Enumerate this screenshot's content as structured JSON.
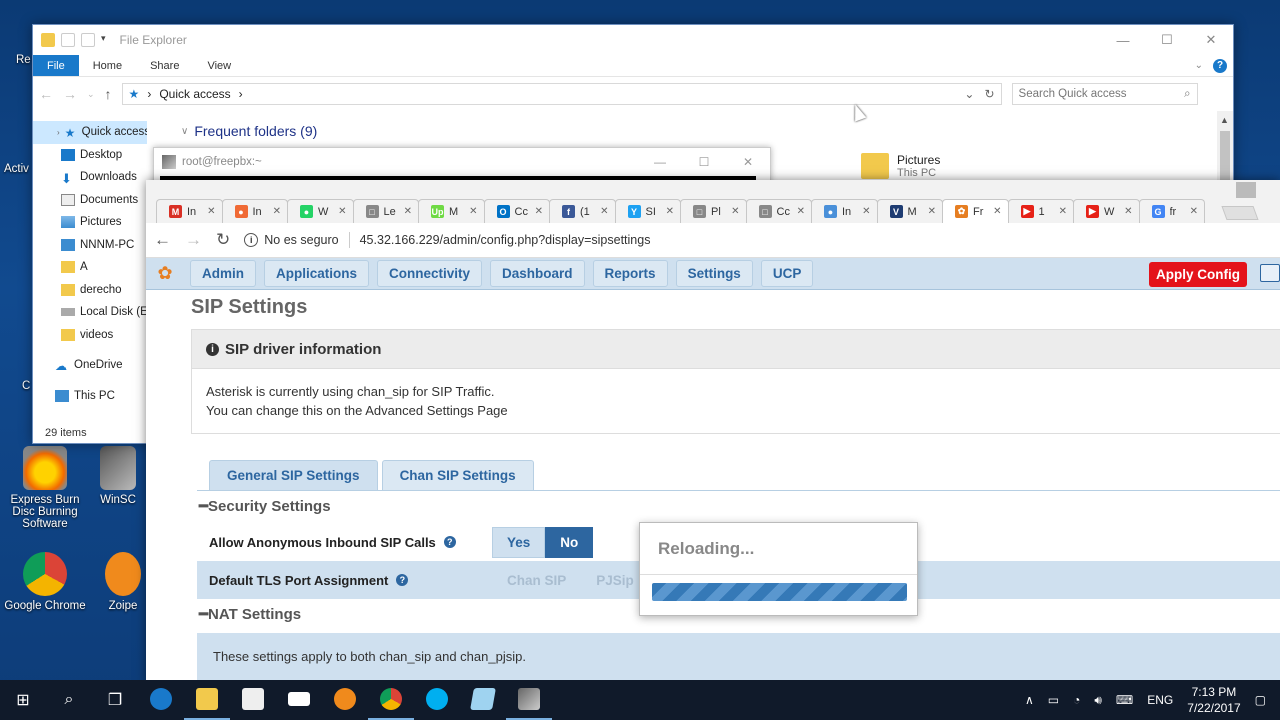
{
  "desktop": {
    "icons": [
      {
        "label": "Express Burn Disc Burning Software"
      },
      {
        "label": "WinSC"
      },
      {
        "label": "Google Chrome"
      },
      {
        "label": "Zoipe"
      }
    ],
    "fragments": [
      "Re",
      "Activ",
      "C"
    ]
  },
  "explorer": {
    "title": "File Explorer",
    "ribbon_tabs": [
      "File",
      "Home",
      "Share",
      "View"
    ],
    "address_label": "Quick access",
    "search_placeholder": "Search Quick access",
    "nav_items": [
      {
        "label": "Quick access",
        "icon": "star-icon"
      },
      {
        "label": "Desktop",
        "icon": "desktop-folder-icon"
      },
      {
        "label": "Downloads",
        "icon": "downloads-icon"
      },
      {
        "label": "Documents",
        "icon": "documents-icon"
      },
      {
        "label": "Pictures",
        "icon": "pictures-icon"
      },
      {
        "label": "NNNM-PC",
        "icon": "computer-icon"
      },
      {
        "label": "A",
        "icon": "folder-icon"
      },
      {
        "label": "derecho",
        "icon": "folder-icon"
      },
      {
        "label": "Local Disk (E:",
        "icon": "drive-icon"
      },
      {
        "label": "videos",
        "icon": "folder-icon"
      },
      {
        "label": "OneDrive",
        "icon": "cloud-icon"
      },
      {
        "label": "This PC",
        "icon": "computer-icon"
      }
    ],
    "status": "29 items",
    "frequent_folders": "Frequent folders (9)",
    "tile": {
      "name": "Pictures",
      "location": "This PC"
    }
  },
  "putty": {
    "title": "root@freepbx:~"
  },
  "browser": {
    "tabs": [
      {
        "label": "In",
        "color": "#d93025",
        "glyph": "M"
      },
      {
        "label": "In",
        "color": "#f06a35",
        "glyph": "●"
      },
      {
        "label": "W",
        "color": "#25d366",
        "glyph": "●"
      },
      {
        "label": "Le",
        "color": "#888888",
        "glyph": "□"
      },
      {
        "label": "M",
        "color": "#6fda44",
        "glyph": "Up"
      },
      {
        "label": "Cc",
        "color": "#0072c6",
        "glyph": "O"
      },
      {
        "label": "(1",
        "color": "#3b5998",
        "glyph": "f"
      },
      {
        "label": "SI",
        "color": "#1da1f2",
        "glyph": "Y"
      },
      {
        "label": "Pl",
        "color": "#888888",
        "glyph": "□"
      },
      {
        "label": "Cc",
        "color": "#888888",
        "glyph": "□"
      },
      {
        "label": "In",
        "color": "#4a90d9",
        "glyph": "●"
      },
      {
        "label": "M",
        "color": "#1e3c72",
        "glyph": "V"
      },
      {
        "label": "Fr",
        "color": "#e67e22",
        "glyph": "✿"
      },
      {
        "label": "1",
        "color": "#e62117",
        "glyph": "▶"
      },
      {
        "label": "W",
        "color": "#e62117",
        "glyph": "▶"
      },
      {
        "label": "fr",
        "color": "#4285f4",
        "glyph": "G"
      }
    ],
    "security_label": "No es seguro",
    "url": "45.32.166.229/admin/config.php?display=sipsettings"
  },
  "freepbx": {
    "menu": [
      "Admin",
      "Applications",
      "Connectivity",
      "Dashboard",
      "Reports",
      "Settings",
      "UCP"
    ],
    "apply_label": "Apply Config",
    "page_title": "SIP Settings",
    "info_title": "SIP driver information",
    "info_line1": "Asterisk is currently using chan_sip for SIP Traffic.",
    "info_line2": "You can change this on the Advanced Settings Page",
    "tabs": [
      "General SIP Settings",
      "Chan SIP Settings"
    ],
    "security_title": "Security Settings",
    "anon_label": "Allow Anonymous Inbound SIP Calls",
    "anon_yes": "Yes",
    "anon_no": "No",
    "tls_label": "Default TLS Port Assignment",
    "tls_opt1": "Chan SIP",
    "tls_opt2": "PJSip",
    "nat_title": "NAT Settings",
    "nat_note": "These settings apply to both chan_sip and chan_pjsip.",
    "reloading": "Reloading..."
  },
  "taskbar": {
    "lang": "ENG",
    "time": "7:13 PM",
    "date": "7/22/2017"
  }
}
